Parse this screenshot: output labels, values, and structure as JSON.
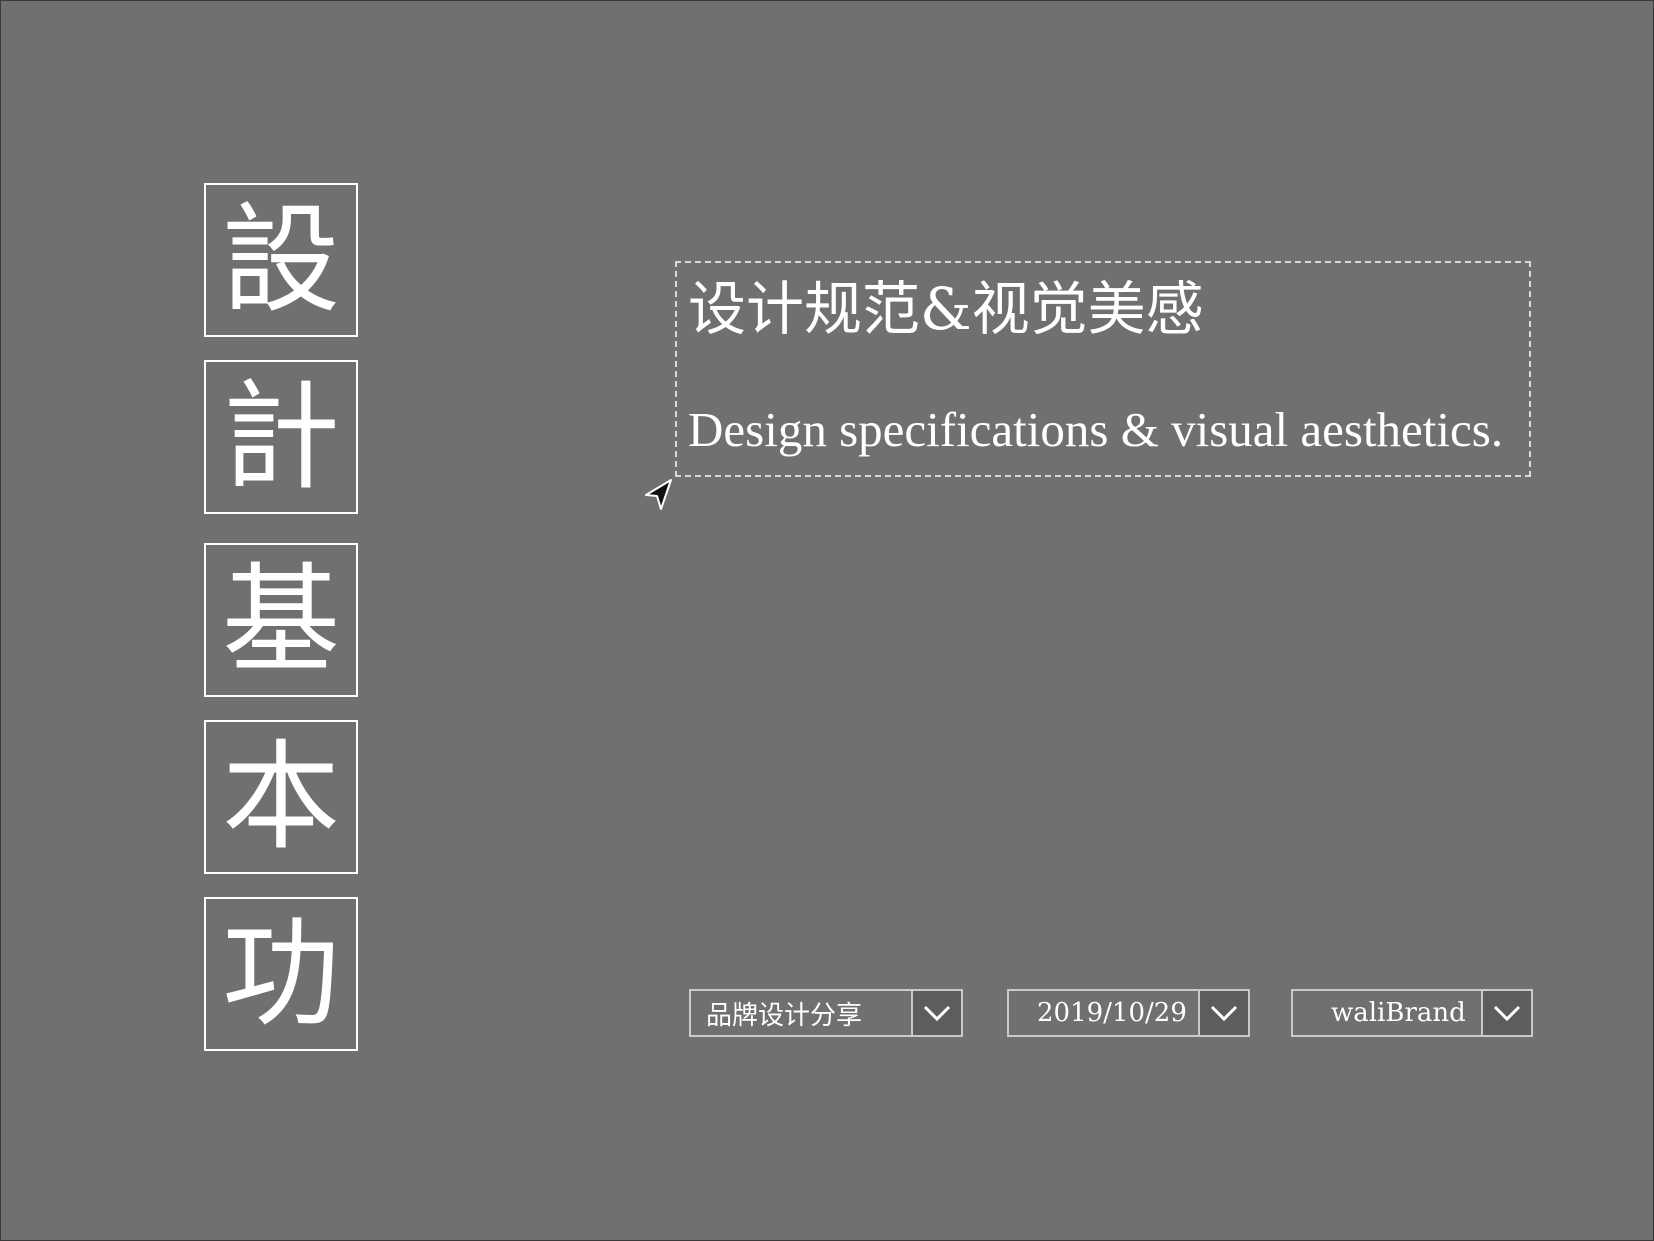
{
  "vertical_title": {
    "chars": [
      "設",
      "計",
      "基",
      "本",
      "功"
    ]
  },
  "headline": {
    "cn": "设计规范&视觉美感",
    "en": "Design specifications & visual aesthetics."
  },
  "dropdowns": [
    {
      "value": "品牌设计分享",
      "icon": "chevron-down-icon"
    },
    {
      "value": "2019/10/29",
      "icon": "chevron-down-icon"
    },
    {
      "value": "waliBrand",
      "icon": "chevron-down-icon"
    }
  ],
  "colors": {
    "background": "#717071",
    "foreground": "#ffffff",
    "border": "#c9c9c9",
    "button": "#5e5d5e"
  }
}
